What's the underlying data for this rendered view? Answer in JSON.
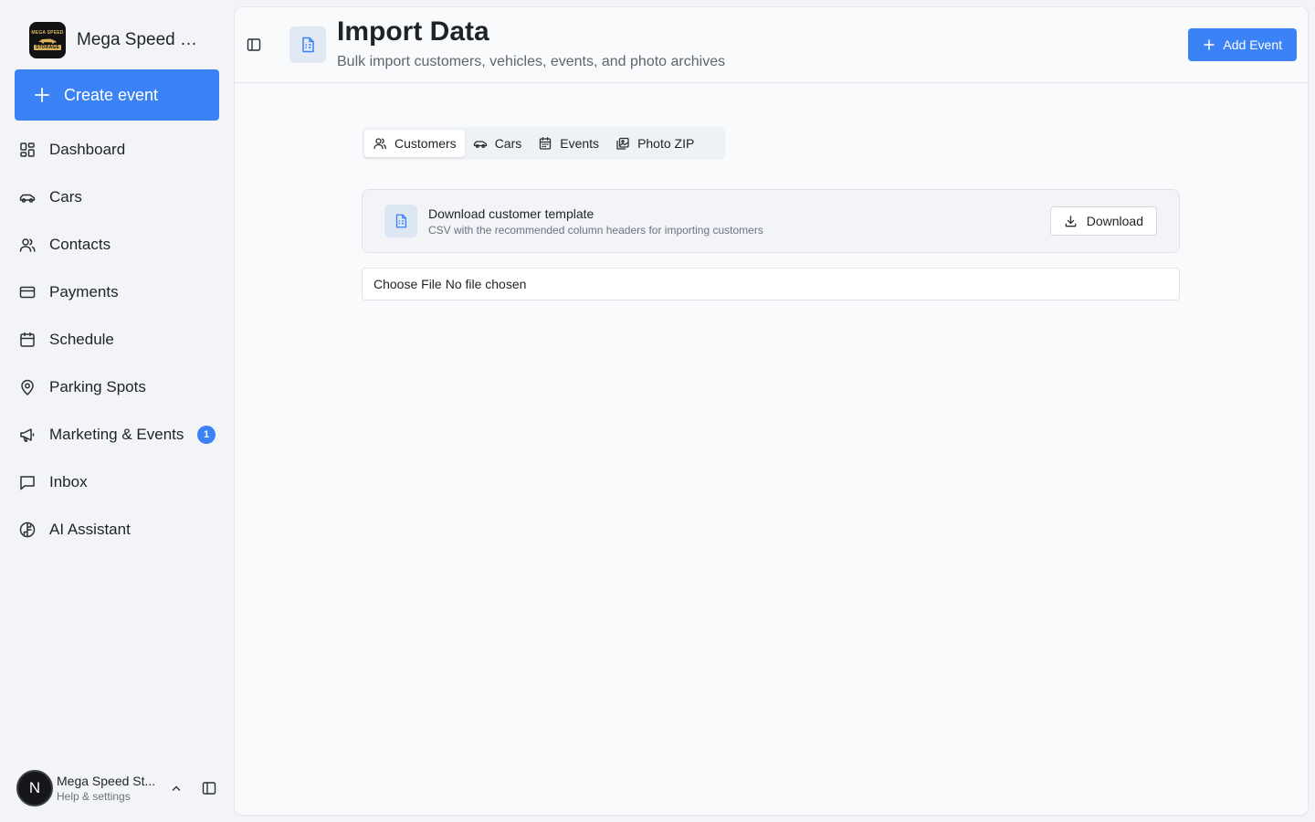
{
  "sidebar": {
    "brand": {
      "name": "Mega Speed St...",
      "logo_text_top": "MEGA SPEED",
      "logo_text_bottom": "STORAGE"
    },
    "create_label": "Create event",
    "items": [
      {
        "label": "Dashboard",
        "icon": "dashboard-icon"
      },
      {
        "label": "Cars",
        "icon": "car-icon"
      },
      {
        "label": "Contacts",
        "icon": "contacts-icon"
      },
      {
        "label": "Payments",
        "icon": "credit-card-icon"
      },
      {
        "label": "Schedule",
        "icon": "calendar-icon"
      },
      {
        "label": "Parking Spots",
        "icon": "map-pin-icon"
      },
      {
        "label": "Marketing & Events",
        "icon": "megaphone-icon",
        "badge": "1"
      },
      {
        "label": "Inbox",
        "icon": "message-square-icon"
      },
      {
        "label": "AI Assistant",
        "icon": "brain-icon"
      }
    ],
    "user": {
      "initial": "N",
      "name": "Mega Speed St...",
      "subtitle": "Help & settings"
    }
  },
  "header": {
    "title": "Import Data",
    "subtitle": "Bulk import customers, vehicles, events, and photo archives",
    "add_label": "Add Event"
  },
  "tabs": [
    {
      "label": "Customers",
      "icon": "users-icon",
      "active": true
    },
    {
      "label": "Cars",
      "icon": "car-icon",
      "active": false
    },
    {
      "label": "Events",
      "icon": "calendar-icon",
      "active": false
    },
    {
      "label": "Photo ZIP",
      "icon": "images-icon",
      "active": false
    }
  ],
  "template": {
    "title": "Download customer template",
    "subtitle": "CSV with the recommended column headers for importing customers",
    "button_label": "Download"
  },
  "file_input": {
    "button_label": "Choose File",
    "status": "No file chosen"
  },
  "colors": {
    "accent": "#3b82f6",
    "background": "#f2f4f7",
    "panel": "#f8fafc"
  }
}
